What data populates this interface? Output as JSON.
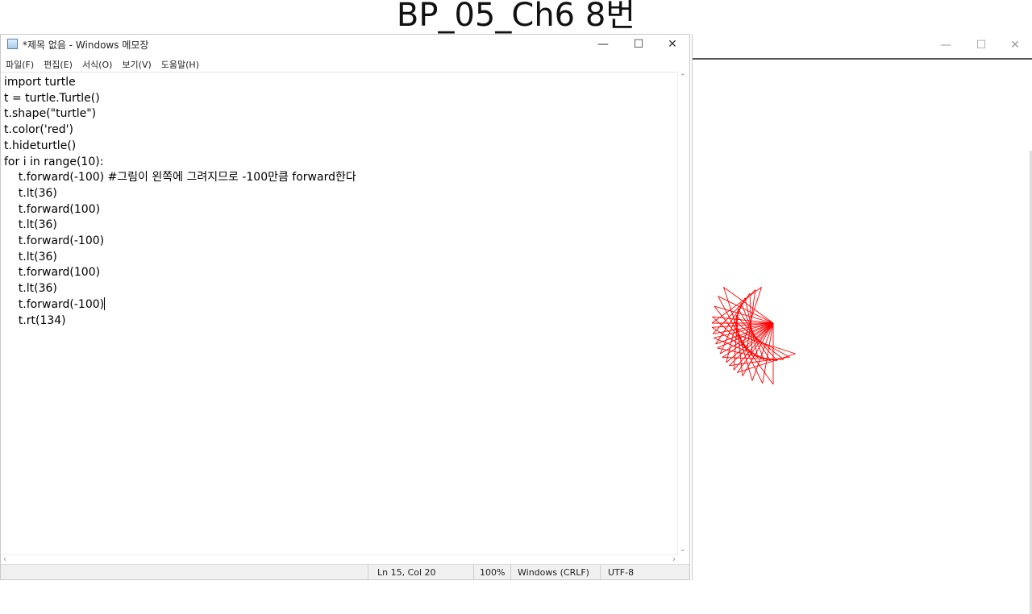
{
  "slide": {
    "title": "BP_05_Ch6 8번"
  },
  "notepad": {
    "window_title": "*제목 없음 - Windows 메모장",
    "controls": {
      "minimize": "—",
      "maximize": "☐",
      "close": "✕"
    },
    "menu": [
      "파일(F)",
      "편집(E)",
      "서식(O)",
      "보기(V)",
      "도움말(H)"
    ],
    "code_lines": [
      "import turtle",
      "t = turtle.Turtle()",
      "t.shape(\"turtle\")",
      "t.color('red')",
      "t.hideturtle()",
      "for i in range(10):",
      "    t.forward(-100) #그림이 왼쪽에 그려지므로 -100만큼 forward한다",
      "    t.lt(36)",
      "    t.forward(100)",
      "    t.lt(36)",
      "    t.forward(-100)",
      "    t.lt(36)",
      "    t.forward(100)",
      "    t.lt(36)",
      "    t.forward(-100)",
      "    t.rt(134)"
    ],
    "status": {
      "position": "Ln 15, Col 20",
      "zoom": "100%",
      "line_ending": "Windows (CRLF)",
      "encoding": "UTF-8"
    }
  },
  "turtle_window": {
    "controls": {
      "minimize": "—",
      "maximize": "☐",
      "close": "✕"
    },
    "pen_color": "#ff0000"
  },
  "colors": {
    "accent": "#ff0000"
  }
}
